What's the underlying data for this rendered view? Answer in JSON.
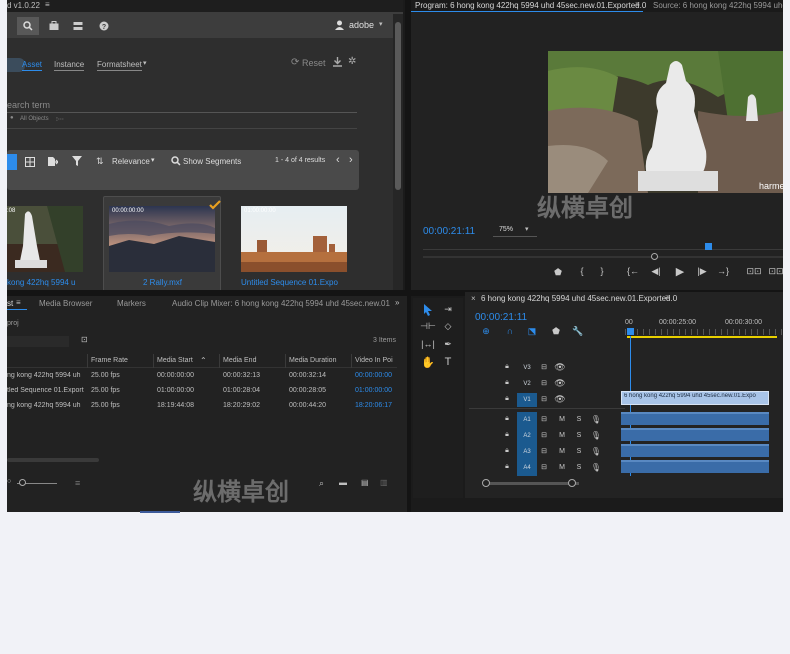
{
  "asset_panel": {
    "version": "d v1.0.22",
    "user": "adobe",
    "tabs": [
      "Asset",
      "Instance",
      "Formatsheet"
    ],
    "reset_label": "Reset",
    "search_placeholder": "earch term",
    "filter_text": "All Objects",
    "sort_label": "Relevance",
    "show_segments_label": "Show Segments",
    "results": "1 - 4 of 4 results",
    "items": [
      {
        "timecode": ":08",
        "caption": "kong 422hq 5994 u"
      },
      {
        "timecode": "00:00:00:00",
        "caption": "2 Rally.mxf"
      },
      {
        "timecode": "01:00:00:00",
        "caption": "Untitled Sequence 01.Expo"
      }
    ]
  },
  "program_monitor": {
    "title": "Program: 6 hong kong 422hq 5994 uhd 45sec.new.01.Exported.0",
    "source_title": "Source: 6 hong kong 422hq 5994 uhd 45sec.ne",
    "timecode": "00:00:21:11",
    "zoom": "75%",
    "watermark_text": "harme"
  },
  "project_panel": {
    "tabs": [
      "st",
      "Media Browser",
      "Markers",
      "Audio Clip Mixer: 6 hong kong 422hq 5994 uhd 45sec.new.01.E"
    ],
    "project_name": "proj",
    "items_count": "3 Items",
    "columns": [
      "Frame Rate",
      "Media Start",
      "Media End",
      "Media Duration",
      "Video In Poi"
    ],
    "rows": [
      {
        "name": "ng kong 422hq 5994 uh",
        "fps": "25.00 fps",
        "start": "00:00:00:00",
        "end": "00:00:32:13",
        "duration": "00:00:32:14",
        "in": "00:00:00:00"
      },
      {
        "name": "tled Sequence 01.Export",
        "fps": "25.00 fps",
        "start": "01:00:00:00",
        "end": "01:00:28:04",
        "duration": "00:00:28:05",
        "in": "01:00:00:00"
      },
      {
        "name": "ng kong 422hq 5994 uh",
        "fps": "25.00 fps",
        "start": "18:19:44:08",
        "end": "18:20:29:02",
        "duration": "00:00:44:20",
        "in": "18:20:06:17"
      }
    ]
  },
  "timeline": {
    "title": "6 hong kong 422hq 5994 uhd 45sec.new.01.Exported.0",
    "timecode": "00:00:21:11",
    "ruler": [
      "00",
      "00:00:25:00",
      "00:00:30:00"
    ],
    "video_tracks": [
      "V3",
      "V2",
      "V1"
    ],
    "audio_tracks": [
      "A1",
      "A2",
      "A3",
      "A4"
    ],
    "clip_name": "6 hong kong 422hq 5994 uhd 45sec.new.01.Expo",
    "m_label": "M",
    "s_label": "S"
  },
  "watermark": "纵横卓创"
}
